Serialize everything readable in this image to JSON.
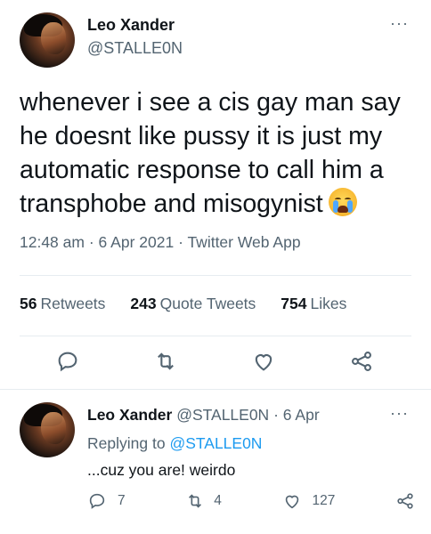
{
  "tweet": {
    "author_name": "Leo Xander",
    "author_handle": "@STALLE0N",
    "text": "whenever i see a cis gay man say he doesnt like pussy it is just my automatic response to call him a transphobe and misogynist",
    "emoji": "loudly-crying-face",
    "time": "12:48 am",
    "date": "6 Apr 2021",
    "source": "Twitter Web App",
    "retweets_count": "56",
    "retweets_label": "Retweets",
    "quote_count": "243",
    "quote_label": "Quote Tweets",
    "likes_count": "754",
    "likes_label": "Likes"
  },
  "reply": {
    "author_name": "Leo Xander",
    "author_handle": "@STALLE0N",
    "date": "6 Apr",
    "replying_to_label": "Replying to",
    "replying_to_handle": "@STALLE0N",
    "text": "...cuz you are! weirdo",
    "reply_count": "7",
    "retweet_count": "4",
    "like_count": "127"
  },
  "separator": "·",
  "more_icon": "···",
  "colors": {
    "text": "#0f1419",
    "secondary": "#536471",
    "accent": "#1d9bf0",
    "divider": "#e6ecf0"
  }
}
